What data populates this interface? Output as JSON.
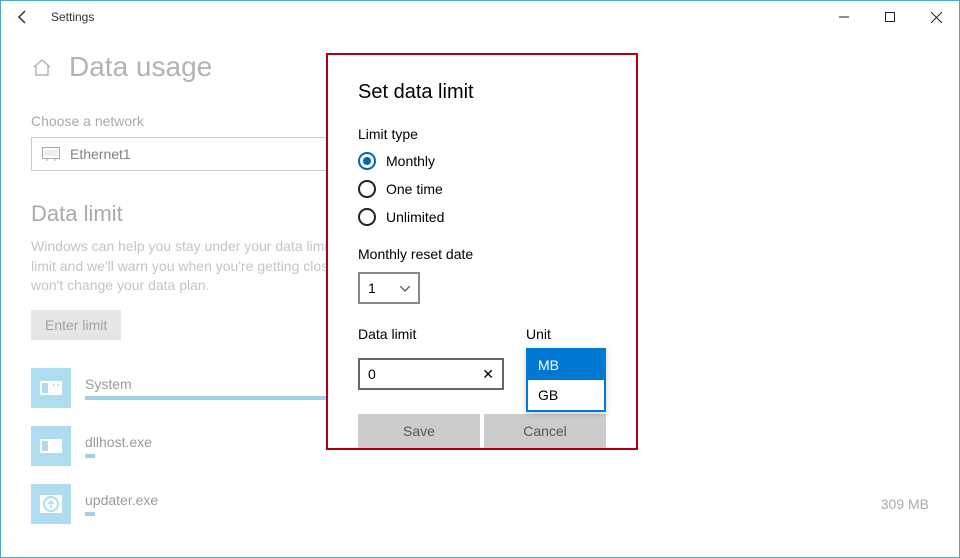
{
  "titlebar": {
    "title": "Settings"
  },
  "page": {
    "title": "Data usage"
  },
  "network": {
    "label": "Choose a network",
    "value": "Ethernet1"
  },
  "dataLimit": {
    "heading": "Data limit",
    "desc": "Windows can help you stay under your data limit. Enter your limit and we'll warn you when you're getting close to it. This won't change your data plan.",
    "enterBtn": "Enter limit"
  },
  "apps": [
    {
      "name": "System",
      "usage": ""
    },
    {
      "name": "dllhost.exe",
      "usage": ""
    },
    {
      "name": "updater.exe",
      "usage": "309 MB"
    }
  ],
  "dialog": {
    "title": "Set data limit",
    "limitTypeLabel": "Limit type",
    "options": {
      "monthly": "Monthly",
      "onetime": "One time",
      "unlimited": "Unlimited"
    },
    "resetLabel": "Monthly reset date",
    "resetValue": "1",
    "dataLimitLabel": "Data limit",
    "dataLimitValue": "0",
    "unitLabel": "Unit",
    "unitOptions": {
      "mb": "MB",
      "gb": "GB"
    },
    "saveBtn": "Save",
    "cancelBtn": "Cancel"
  }
}
